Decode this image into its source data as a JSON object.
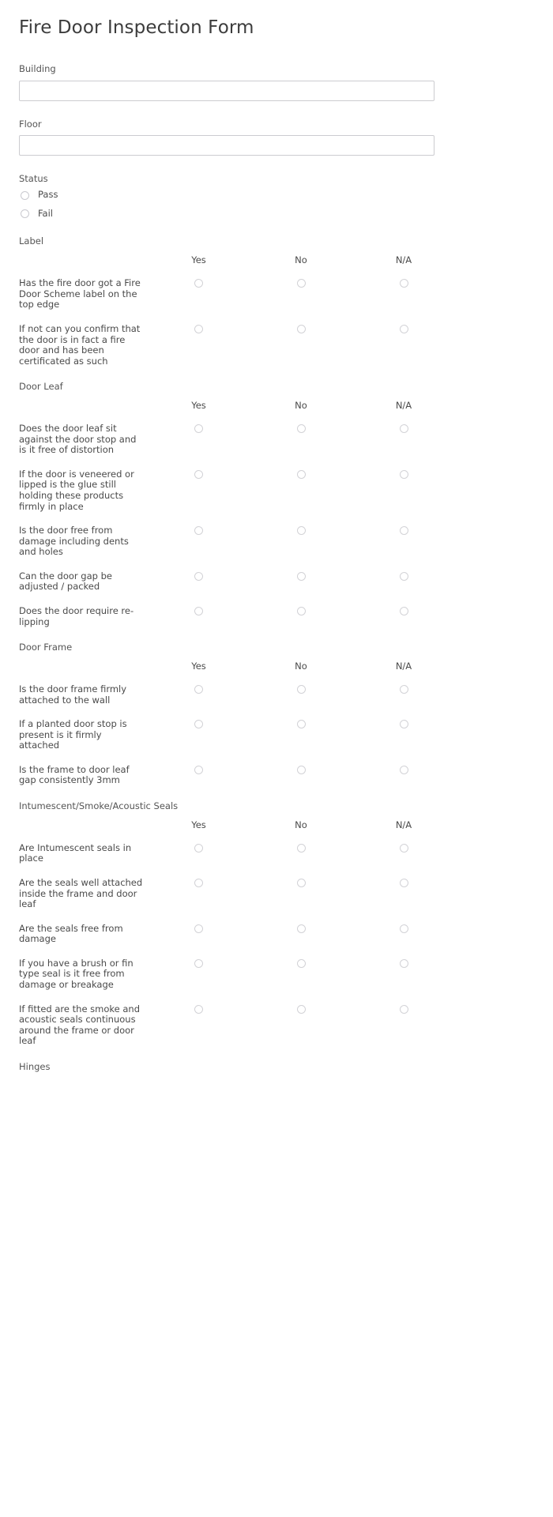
{
  "page": {
    "title": "Fire Door Inspection Form"
  },
  "fields": [
    {
      "label": "Building",
      "value": "",
      "placeholder": ""
    },
    {
      "label": "Floor",
      "value": "",
      "placeholder": ""
    }
  ],
  "status": {
    "label": "Status",
    "options": [
      {
        "label": "Pass",
        "selected": false
      },
      {
        "label": "Fail",
        "selected": false
      }
    ]
  },
  "columns": [
    "Yes",
    "No",
    "N/A"
  ],
  "sections": [
    {
      "title": "Label",
      "questions": [
        "Has the fire door got a Fire Door Scheme label on the top edge",
        "If not can you confirm that the door is in fact a fire door and has been certificated as such"
      ]
    },
    {
      "title": "Door Leaf",
      "questions": [
        "Does the door leaf sit against the door stop and is it free of distortion",
        "If the door is veneered or lipped is the glue still holding these products firmly in place",
        "Is the door free from damage including dents and holes",
        "Can the door gap be adjusted / packed",
        "Does the door require re-lipping"
      ]
    },
    {
      "title": "Door Frame",
      "questions": [
        "Is the door frame firmly attached to the wall",
        "If a planted door stop is present is it firmly attached",
        "Is the frame to door leaf gap consistently 3mm"
      ]
    },
    {
      "title": "Intumescent/Smoke/Acoustic Seals",
      "questions": [
        "Are Intumescent seals in place",
        "Are the seals well attached inside the frame and door leaf",
        "Are the seals free from damage",
        "If you have a brush or fin type seal is it free from damage or breakage",
        "If fitted are the smoke and acoustic seals continuous around the frame or door leaf"
      ]
    },
    {
      "title": "Hinges",
      "questions": []
    }
  ],
  "colors": {
    "text": "#4a4a4a",
    "title": "#3c3c3c",
    "border": "#ccccd0",
    "radio_border": "#d2d2d6",
    "background": "#ffffff"
  }
}
